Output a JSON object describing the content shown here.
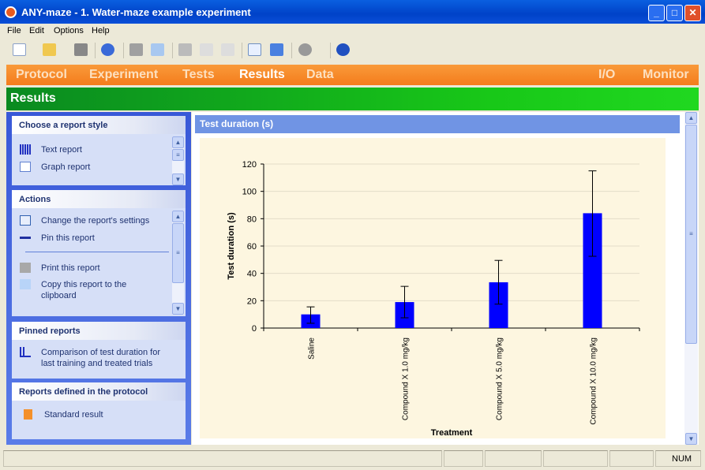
{
  "window": {
    "title": "ANY-maze - 1. Water-maze example experiment",
    "minimize": "_",
    "maximize": "□",
    "close": "✕"
  },
  "menu": [
    "File",
    "Edit",
    "Options",
    "Help"
  ],
  "toolbar": [
    "new-icon",
    "open-icon",
    "save-icon",
    "send-icon",
    "print-icon",
    "email-icon",
    "cut-icon",
    "copy-icon",
    "paste-icon",
    "checklist-icon",
    "device-icon",
    "audio-icon",
    "help-icon"
  ],
  "nav": {
    "left": [
      "Protocol",
      "Experiment",
      "Tests",
      "Results",
      "Data"
    ],
    "right": [
      "I/O",
      "Monitor"
    ],
    "active": "Results"
  },
  "section_title": "Results",
  "sidebar": {
    "report_style": {
      "title": "Choose a report style",
      "items": [
        "Text report",
        "Graph report"
      ],
      "selected": "Graph report"
    },
    "actions": {
      "title": "Actions",
      "items": [
        "Change the report's settings",
        "Pin this report",
        "Print this report",
        "Copy this report to the clipboard"
      ]
    },
    "pinned": {
      "title": "Pinned reports",
      "items": [
        "Comparison of test duration for last training and treated trials"
      ]
    },
    "protocol_reports": {
      "title": "Reports defined in the protocol",
      "items": [
        "Standard result"
      ]
    }
  },
  "report": {
    "title": "Test duration (s)"
  },
  "status": {
    "num": "NUM"
  },
  "colors": {
    "bar": "#0000ff",
    "nav": "#f47c1c",
    "chart_bg": "#fdf6e0"
  },
  "chart_data": {
    "type": "bar",
    "categories": [
      "Saline",
      "Compound X 1.0 mg/kg",
      "Compound X 5.0 mg/kg",
      "Compound X 10.0 mg/kg"
    ],
    "values": [
      10,
      19,
      33.5,
      84
    ],
    "error_low": [
      3.5,
      7.5,
      17.5,
      52.5
    ],
    "error_high": [
      15.5,
      30.5,
      49.5,
      115
    ],
    "xlabel": "Treatment",
    "ylabel": "Test duration (s)",
    "ylim": [
      0,
      120
    ],
    "yticks": [
      0,
      20,
      40,
      60,
      80,
      100,
      120
    ],
    "grid": true
  }
}
